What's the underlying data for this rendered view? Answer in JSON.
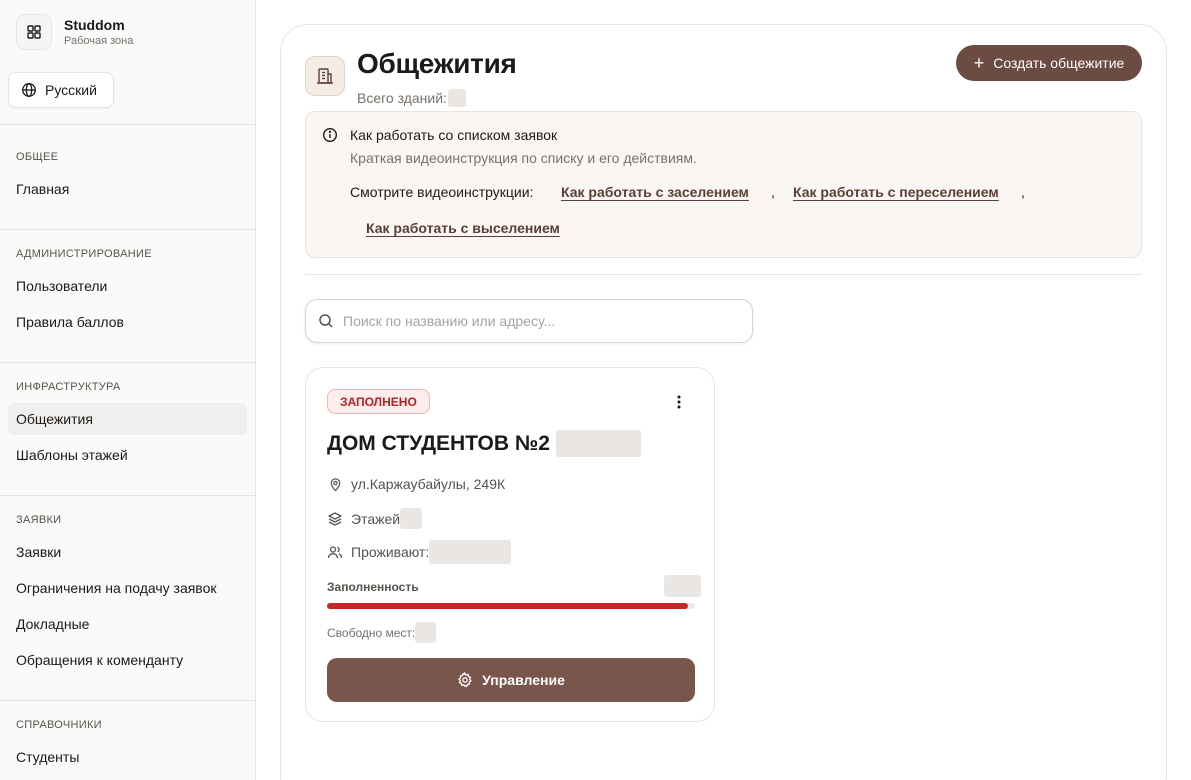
{
  "app": {
    "name": "Studdom",
    "subtitle": "Рабочая зона"
  },
  "language": {
    "label": "Русский"
  },
  "sidebar": {
    "sections": [
      {
        "title": "ОБЩЕЕ",
        "items": [
          "Главная"
        ]
      },
      {
        "title": "АДМИНИСТРИРОВАНИЕ",
        "items": [
          "Пользователи",
          "Правила баллов"
        ]
      },
      {
        "title": "ИНФРАСТРУКТУРА",
        "items": [
          "Общежития",
          "Шаблоны этажей"
        ]
      },
      {
        "title": "ЗАЯВКИ",
        "items": [
          "Заявки",
          "Ограничения на подачу заявок",
          "Докладные",
          "Обращения к коменданту"
        ]
      },
      {
        "title": "СПРАВОЧНИКИ",
        "items": [
          "Студенты"
        ]
      }
    ],
    "active_item": "Общежития"
  },
  "header": {
    "title": "Общежития",
    "total_label": "Всего зданий:",
    "create_button": "Создать общежитие"
  },
  "info": {
    "title": "Как работать со списком заявок",
    "description": "Краткая видеоинструкция по списку и его действиям.",
    "links_label": "Смотрите видеоинструкции:",
    "links": [
      "Как работать с заселением",
      "Как работать с переселением",
      "Как работать с выселением"
    ]
  },
  "search": {
    "placeholder": "Поиск по названию или адресу..."
  },
  "dormitory": {
    "status": "ЗАПОЛНЕНО",
    "name": "ДОМ СТУДЕНТОВ №2",
    "address": "ул.Каржаубайулы, 249К",
    "floors_label": "Этажей",
    "residents_label": "Проживают:",
    "occupancy_label": "Заполненность",
    "occupancy_fraction": 0.98,
    "free_label": "Свободно мест:",
    "manage_button": "Управление"
  },
  "colors": {
    "accent": "#6b4b42",
    "manage_button": "#7a554b",
    "status_full": "#b42222",
    "bar_fill": "#c62828"
  },
  "icons": {
    "brand": "grid-icon",
    "language": "globe-icon",
    "header": "building-icon",
    "info": "info-icon",
    "search": "search-icon",
    "menu": "more-vertical-icon",
    "address": "map-pin-icon",
    "floors": "layers-icon",
    "residents": "users-icon",
    "manage": "gear-icon"
  }
}
